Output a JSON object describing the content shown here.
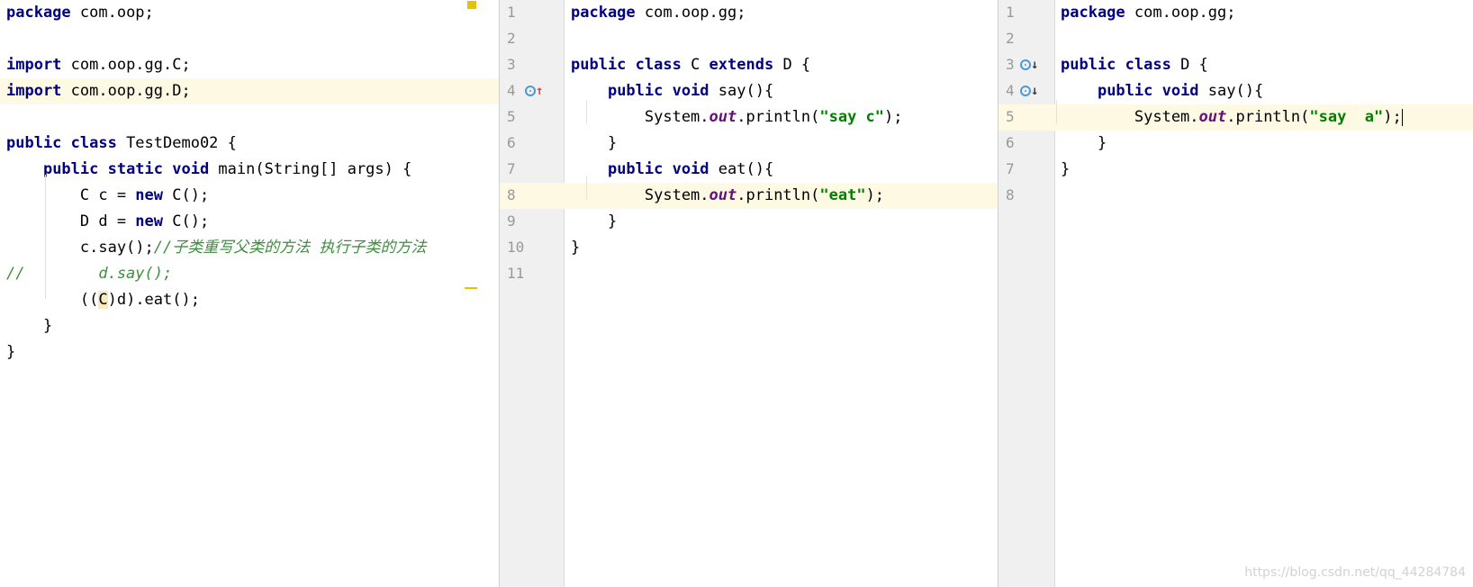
{
  "editor1": {
    "file": "TestDemo02",
    "lines": [
      {
        "parts": [
          {
            "t": "package",
            "c": "kw"
          },
          {
            "t": " com.oop;",
            "c": ""
          }
        ]
      },
      {
        "parts": []
      },
      {
        "parts": [
          {
            "t": "import",
            "c": "kw"
          },
          {
            "t": " com.oop.gg.C;",
            "c": ""
          }
        ]
      },
      {
        "parts": [
          {
            "t": "import",
            "c": "kw"
          },
          {
            "t": " com.oop.gg.D;",
            "c": ""
          }
        ],
        "hl": true
      },
      {
        "parts": []
      },
      {
        "parts": [
          {
            "t": "public class",
            "c": "kw"
          },
          {
            "t": " TestDemo02 {",
            "c": ""
          }
        ]
      },
      {
        "parts": [
          {
            "t": "    ",
            "c": ""
          },
          {
            "t": "public static void",
            "c": "kw"
          },
          {
            "t": " main(String[] args) {",
            "c": ""
          }
        ]
      },
      {
        "parts": [
          {
            "t": "        C c = ",
            "c": ""
          },
          {
            "t": "new",
            "c": "kw"
          },
          {
            "t": " C();",
            "c": ""
          }
        ]
      },
      {
        "parts": [
          {
            "t": "        D d = ",
            "c": ""
          },
          {
            "t": "new",
            "c": "kw"
          },
          {
            "t": " C();",
            "c": ""
          }
        ]
      },
      {
        "parts": [
          {
            "t": "        c.say();",
            "c": ""
          },
          {
            "t": "//子类重写父类的方法 执行子类的方法",
            "c": "cmt"
          }
        ]
      },
      {
        "parts": [
          {
            "t": "//        d.say();",
            "c": "cmt"
          }
        ]
      },
      {
        "parts": [
          {
            "t": "        ((",
            "c": ""
          },
          {
            "t": "C",
            "c": "paren-hl"
          },
          {
            "t": ")d).eat();",
            "c": ""
          }
        ]
      },
      {
        "parts": [
          {
            "t": "    }",
            "c": ""
          }
        ]
      },
      {
        "parts": [
          {
            "t": "}",
            "c": ""
          }
        ]
      }
    ]
  },
  "editor2": {
    "file": "C",
    "lines": [
      {
        "n": "1",
        "parts": [
          {
            "t": "package",
            "c": "kw"
          },
          {
            "t": " com.oop.gg;",
            "c": ""
          }
        ]
      },
      {
        "n": "2",
        "parts": []
      },
      {
        "n": "3",
        "parts": [
          {
            "t": "public class",
            "c": "kw"
          },
          {
            "t": " C ",
            "c": ""
          },
          {
            "t": "extends",
            "c": "kw"
          },
          {
            "t": " D {",
            "c": ""
          }
        ]
      },
      {
        "n": "4",
        "parts": [
          {
            "t": "    ",
            "c": ""
          },
          {
            "t": "public void",
            "c": "kw"
          },
          {
            "t": " say(){",
            "c": ""
          }
        ],
        "icon": "override-up"
      },
      {
        "n": "5",
        "parts": [
          {
            "t": "        System.",
            "c": ""
          },
          {
            "t": "out",
            "c": "fld"
          },
          {
            "t": ".println(",
            "c": ""
          },
          {
            "t": "\"say c\"",
            "c": "str"
          },
          {
            "t": ");",
            "c": ""
          }
        ]
      },
      {
        "n": "6",
        "parts": [
          {
            "t": "    }",
            "c": ""
          }
        ]
      },
      {
        "n": "7",
        "parts": [
          {
            "t": "    ",
            "c": ""
          },
          {
            "t": "public void",
            "c": "kw"
          },
          {
            "t": " eat(){",
            "c": ""
          }
        ]
      },
      {
        "n": "8",
        "parts": [
          {
            "t": "        System.",
            "c": ""
          },
          {
            "t": "out",
            "c": "fld"
          },
          {
            "t": ".println(",
            "c": ""
          },
          {
            "t": "\"eat\"",
            "c": "str"
          },
          {
            "t": ");",
            "c": ""
          }
        ],
        "hl": true
      },
      {
        "n": "9",
        "parts": [
          {
            "t": "    }",
            "c": ""
          }
        ]
      },
      {
        "n": "10",
        "parts": [
          {
            "t": "}",
            "c": ""
          }
        ]
      },
      {
        "n": "11",
        "parts": []
      }
    ]
  },
  "editor3": {
    "file": "D",
    "lines": [
      {
        "n": "1",
        "parts": [
          {
            "t": "package",
            "c": "kw"
          },
          {
            "t": " com.oop.gg;",
            "c": ""
          }
        ]
      },
      {
        "n": "2",
        "parts": []
      },
      {
        "n": "3",
        "parts": [
          {
            "t": "public class",
            "c": "kw"
          },
          {
            "t": " D {",
            "c": ""
          }
        ],
        "icon": "implemented-down"
      },
      {
        "n": "4",
        "parts": [
          {
            "t": "    ",
            "c": ""
          },
          {
            "t": "public void",
            "c": "kw"
          },
          {
            "t": " say(){",
            "c": ""
          }
        ],
        "icon": "implemented-down"
      },
      {
        "n": "5",
        "parts": [
          {
            "t": "        System.",
            "c": ""
          },
          {
            "t": "out",
            "c": "fld"
          },
          {
            "t": ".println(",
            "c": ""
          },
          {
            "t": "\"say  a\"",
            "c": "str"
          },
          {
            "t": ");",
            "c": ""
          }
        ],
        "hl": true,
        "caret": true
      },
      {
        "n": "6",
        "parts": [
          {
            "t": "    }",
            "c": ""
          }
        ]
      },
      {
        "n": "7",
        "parts": [
          {
            "t": "}",
            "c": ""
          }
        ]
      },
      {
        "n": "8",
        "parts": []
      }
    ]
  },
  "watermark": "https://blog.csdn.net/qq_44284784",
  "colors": {
    "keyword": "#000080",
    "string": "#008000",
    "field": "#660e7a",
    "comment": "#3c8f3c",
    "current_line": "#fdf9e3"
  }
}
